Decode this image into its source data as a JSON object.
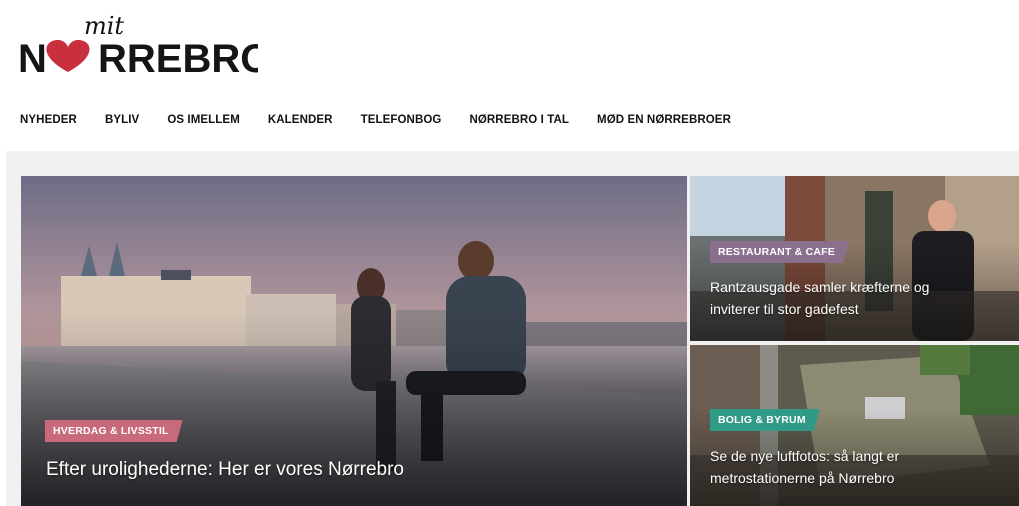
{
  "brand": {
    "logo_top": "mit",
    "logo_main": "NØRREBRO",
    "accent_heart": "#c8303f"
  },
  "nav": {
    "items": [
      {
        "label": "NYHEDER"
      },
      {
        "label": "BYLIV"
      },
      {
        "label": "OS IMELLEM"
      },
      {
        "label": "KALENDER"
      },
      {
        "label": "TELEFONBOG"
      },
      {
        "label": "NØRREBRO I TAL"
      },
      {
        "label": "MØD EN NØRREBROER"
      }
    ]
  },
  "articles": {
    "hero": {
      "category": "HVERDAG & LIVSSTIL",
      "title": "Efter urolighederne: Her er vores Nørrebro",
      "tag_color": "#c96a7c"
    },
    "side_top": {
      "category": "RESTAURANT & CAFE",
      "title": "Rantzausgade samler kræfterne og inviterer til stor gadefest",
      "tag_color": "#8a6f8e"
    },
    "side_bottom": {
      "category": "BOLIG & BYRUM",
      "title": "Se de nye luftfotos: så langt er metrostationerne på Nørrebro",
      "tag_color": "#2f9a86"
    }
  }
}
